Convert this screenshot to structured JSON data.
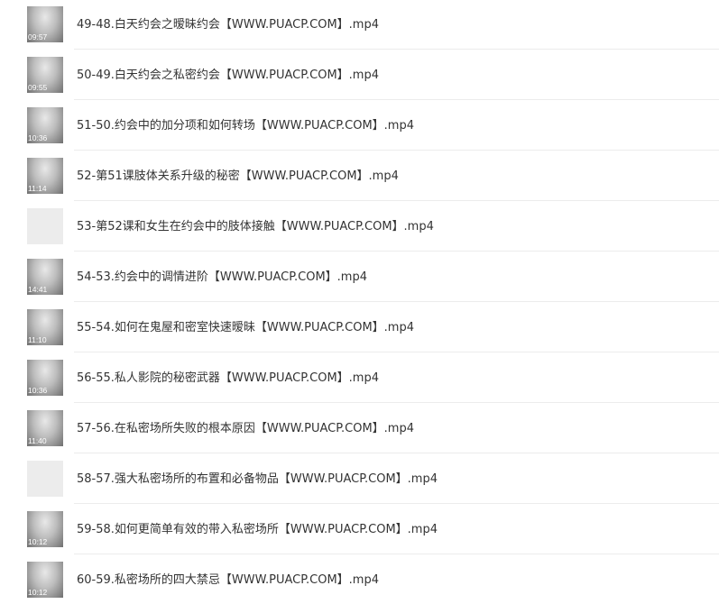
{
  "files": [
    {
      "name": "49-48.白天约会之暧昧约会【WWW.PUACP.COM】.mp4",
      "duration": "09:57",
      "thumb_icon": "video-thumbnail-icon"
    },
    {
      "name": "50-49.白天约会之私密约会【WWW.PUACP.COM】.mp4",
      "duration": "09:55",
      "thumb_icon": "video-thumbnail-icon"
    },
    {
      "name": "51-50.约会中的加分项和如何转场【WWW.PUACP.COM】.mp4",
      "duration": "10:36",
      "thumb_icon": "video-thumbnail-icon"
    },
    {
      "name": "52-第51课肢体关系升级的秘密【WWW.PUACP.COM】.mp4",
      "duration": "11:14",
      "thumb_icon": "video-thumbnail-icon"
    },
    {
      "name": "53-第52课和女生在约会中的肢体接触【WWW.PUACP.COM】.mp4",
      "duration": "",
      "thumb_icon": "blank-thumbnail-icon"
    },
    {
      "name": "54-53.约会中的调情进阶【WWW.PUACP.COM】.mp4",
      "duration": "14:41",
      "thumb_icon": "video-thumbnail-icon"
    },
    {
      "name": "55-54.如何在鬼屋和密室快速暧昧【WWW.PUACP.COM】.mp4",
      "duration": "11:10",
      "thumb_icon": "video-thumbnail-icon"
    },
    {
      "name": "56-55.私人影院的秘密武器【WWW.PUACP.COM】.mp4",
      "duration": "10:36",
      "thumb_icon": "video-thumbnail-icon"
    },
    {
      "name": "57-56.在私密场所失败的根本原因【WWW.PUACP.COM】.mp4",
      "duration": "11:40",
      "thumb_icon": "video-thumbnail-icon"
    },
    {
      "name": "58-57.强大私密场所的布置和必备物品【WWW.PUACP.COM】.mp4",
      "duration": "",
      "thumb_icon": "blank-thumbnail-icon"
    },
    {
      "name": "59-58.如何更简单有效的带入私密场所【WWW.PUACP.COM】.mp4",
      "duration": "10:12",
      "thumb_icon": "video-thumbnail-icon"
    },
    {
      "name": "60-59.私密场所的四大禁忌【WWW.PUACP.COM】.mp4",
      "duration": "10:12",
      "thumb_icon": "video-thumbnail-icon"
    }
  ],
  "colors": {
    "text": "#333333",
    "divider": "#ececec",
    "thumb_placeholder": "#ececec",
    "background": "#ffffff"
  }
}
